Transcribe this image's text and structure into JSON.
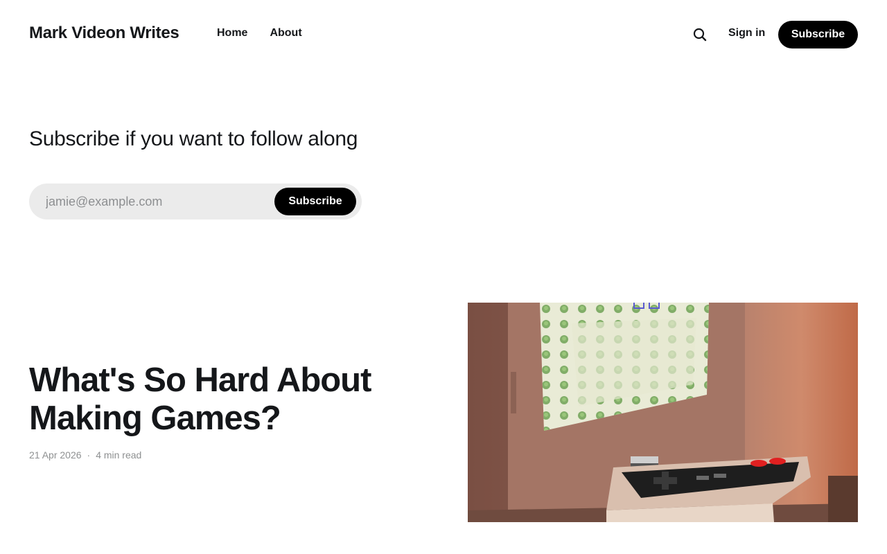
{
  "header": {
    "site_title": "Mark Videon Writes",
    "nav": [
      "Home",
      "About"
    ],
    "search_icon": "search-icon",
    "signin_label": "Sign in",
    "subscribe_label": "Subscribe"
  },
  "cta": {
    "heading": "Subscribe if you want to follow along",
    "email_placeholder": "jamie@example.com",
    "submit_label": "Subscribe"
  },
  "post": {
    "title": "What's So Hard About Making Games?",
    "date": "21 Apr 2026",
    "separator": "·",
    "reading_time": "4 min read"
  },
  "colors": {
    "text": "#15171a",
    "button_bg": "#000000",
    "input_bg": "#ebebeb",
    "muted": "#8e9091"
  }
}
